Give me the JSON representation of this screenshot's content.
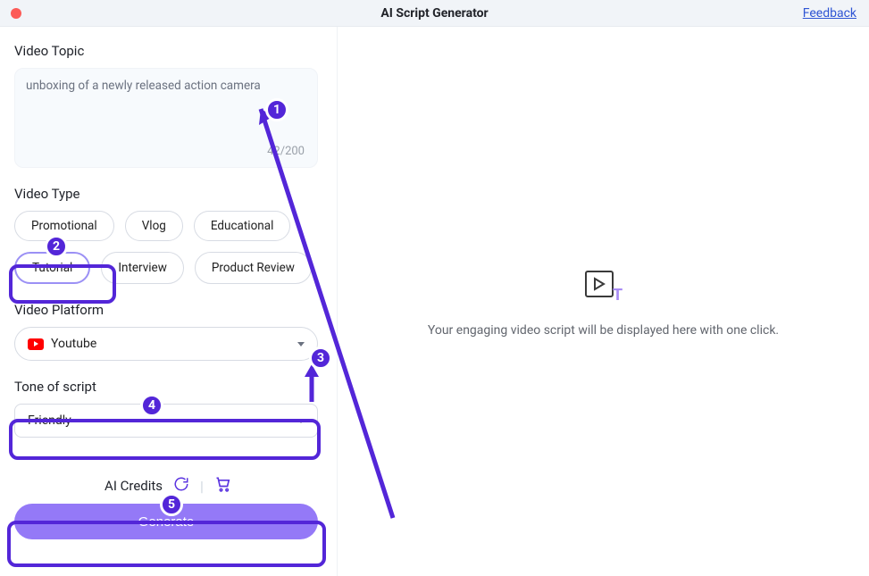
{
  "header": {
    "title": "AI Script Generator",
    "feedback": "Feedback"
  },
  "topic": {
    "label": "Video Topic",
    "value": "unboxing of a newly released action camera",
    "counter": "42/200"
  },
  "video_type": {
    "label": "Video Type",
    "options": [
      "Promotional",
      "Vlog",
      "Educational",
      "Tutorial",
      "Interview",
      "Product Review"
    ],
    "selected": "Tutorial"
  },
  "platform": {
    "label": "Video Platform",
    "selected": "Youtube"
  },
  "tone": {
    "label": "Tone of script",
    "selected": "Friendly"
  },
  "credits": {
    "label": "AI Credits"
  },
  "buttons": {
    "generate": "Generate"
  },
  "right_panel": {
    "placeholder": "Your engaging video script will be displayed here with one click."
  },
  "annotations": {
    "1": "1",
    "2": "2",
    "3": "3",
    "4": "4",
    "5": "5"
  }
}
